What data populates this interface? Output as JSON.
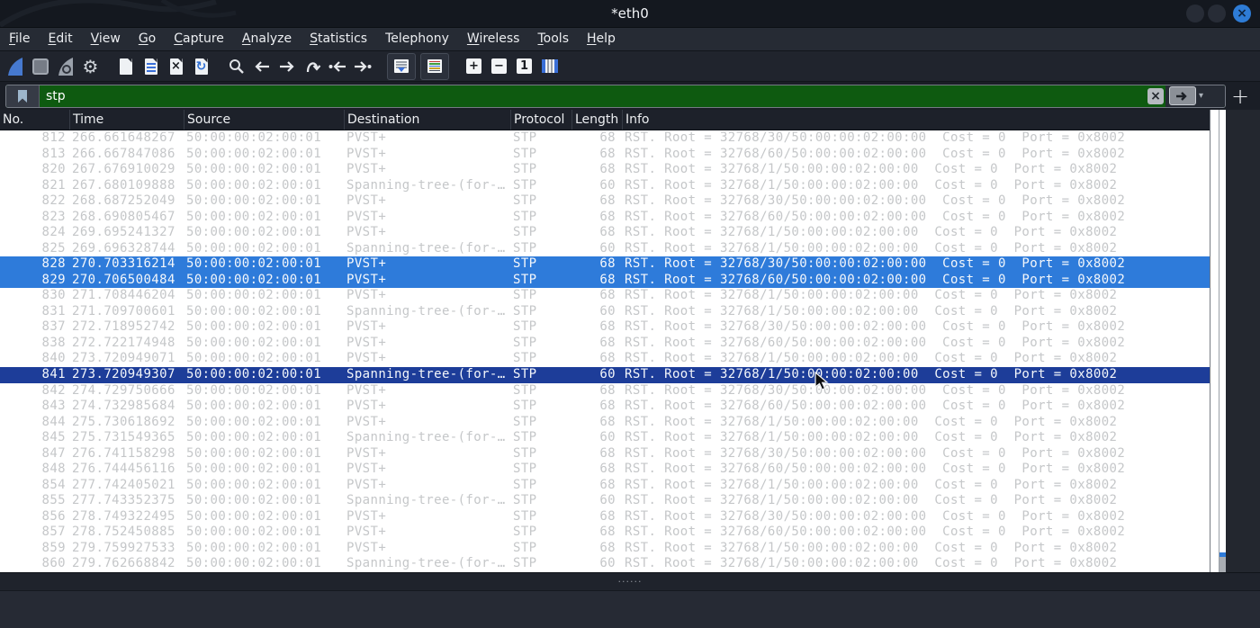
{
  "window": {
    "title": "*eth0"
  },
  "menu": {
    "items": [
      {
        "label": "File",
        "mnemonic": true
      },
      {
        "label": "Edit",
        "mnemonic": true
      },
      {
        "label": "View",
        "mnemonic": true
      },
      {
        "label": "Go",
        "mnemonic": true
      },
      {
        "label": "Capture",
        "mnemonic": true
      },
      {
        "label": "Analyze",
        "mnemonic": true
      },
      {
        "label": "Statistics",
        "mnemonic": true
      },
      {
        "label": "Telephony",
        "mnemonic": false
      },
      {
        "label": "Wireless",
        "mnemonic": true
      },
      {
        "label": "Tools",
        "mnemonic": true
      },
      {
        "label": "Help",
        "mnemonic": true
      }
    ]
  },
  "toolbar": {
    "icons": [
      "start-capture",
      "stop-capture",
      "restart-capture",
      "capture-options",
      "open-file",
      "save-file",
      "close-file",
      "reload-file",
      "find-packet",
      "go-back",
      "go-forward",
      "go-to-packet",
      "go-first-packet",
      "go-last-packet",
      "auto-scroll",
      "colorize-packets",
      "zoom-in",
      "zoom-out",
      "normal-size",
      "resize-columns"
    ]
  },
  "icons": {
    "glyphs": {
      "gear": "⚙",
      "reload": "↻",
      "close_doc_x": "×",
      "zoom_in": "+",
      "zoom_out": "−",
      "normal_size": "1",
      "caret": "▾",
      "clear_x": "×",
      "close_x": "×",
      "plus": "+",
      "dots": "······"
    }
  },
  "filter": {
    "value": "stp"
  },
  "packet_table": {
    "columns": [
      "No.",
      "Time",
      "Source",
      "Destination",
      "Protocol",
      "Length",
      "Info"
    ],
    "rows": [
      [
        "812",
        "266.661648267",
        "50:00:00:02:00:01",
        "PVST+",
        "STP",
        "68",
        "RST. Root = 32768/30/50:00:00:02:00:00  Cost = 0  Port = 0x8002",
        ""
      ],
      [
        "813",
        "266.667847086",
        "50:00:00:02:00:01",
        "PVST+",
        "STP",
        "68",
        "RST. Root = 32768/60/50:00:00:02:00:00  Cost = 0  Port = 0x8002",
        ""
      ],
      [
        "820",
        "267.676910029",
        "50:00:00:02:00:01",
        "PVST+",
        "STP",
        "68",
        "RST. Root = 32768/1/50:00:00:02:00:00  Cost = 0  Port = 0x8002",
        ""
      ],
      [
        "821",
        "267.680109888",
        "50:00:00:02:00:01",
        "Spanning-tree-(for-…",
        "STP",
        "60",
        "RST. Root = 32768/1/50:00:00:02:00:00  Cost = 0  Port = 0x8002",
        ""
      ],
      [
        "822",
        "268.687252049",
        "50:00:00:02:00:01",
        "PVST+",
        "STP",
        "68",
        "RST. Root = 32768/30/50:00:00:02:00:00  Cost = 0  Port = 0x8002",
        ""
      ],
      [
        "823",
        "268.690805467",
        "50:00:00:02:00:01",
        "PVST+",
        "STP",
        "68",
        "RST. Root = 32768/60/50:00:00:02:00:00  Cost = 0  Port = 0x8002",
        ""
      ],
      [
        "824",
        "269.695241327",
        "50:00:00:02:00:01",
        "PVST+",
        "STP",
        "68",
        "RST. Root = 32768/1/50:00:00:02:00:00  Cost = 0  Port = 0x8002",
        ""
      ],
      [
        "825",
        "269.696328744",
        "50:00:00:02:00:01",
        "Spanning-tree-(for-…",
        "STP",
        "60",
        "RST. Root = 32768/1/50:00:00:02:00:00  Cost = 0  Port = 0x8002",
        ""
      ],
      [
        "828",
        "270.703316214",
        "50:00:00:02:00:01",
        "PVST+",
        "STP",
        "68",
        "RST. Root = 32768/30/50:00:00:02:00:00  Cost = 0  Port = 0x8002",
        "highlight"
      ],
      [
        "829",
        "270.706500484",
        "50:00:00:02:00:01",
        "PVST+",
        "STP",
        "68",
        "RST. Root = 32768/60/50:00:00:02:00:00  Cost = 0  Port = 0x8002",
        "highlight"
      ],
      [
        "830",
        "271.708446204",
        "50:00:00:02:00:01",
        "PVST+",
        "STP",
        "68",
        "RST. Root = 32768/1/50:00:00:02:00:00  Cost = 0  Port = 0x8002",
        ""
      ],
      [
        "831",
        "271.709700601",
        "50:00:00:02:00:01",
        "Spanning-tree-(for-…",
        "STP",
        "60",
        "RST. Root = 32768/1/50:00:00:02:00:00  Cost = 0  Port = 0x8002",
        ""
      ],
      [
        "837",
        "272.718952742",
        "50:00:00:02:00:01",
        "PVST+",
        "STP",
        "68",
        "RST. Root = 32768/30/50:00:00:02:00:00  Cost = 0  Port = 0x8002",
        ""
      ],
      [
        "838",
        "272.722174948",
        "50:00:00:02:00:01",
        "PVST+",
        "STP",
        "68",
        "RST. Root = 32768/60/50:00:00:02:00:00  Cost = 0  Port = 0x8002",
        ""
      ],
      [
        "840",
        "273.720949071",
        "50:00:00:02:00:01",
        "PVST+",
        "STP",
        "68",
        "RST. Root = 32768/1/50:00:00:02:00:00  Cost = 0  Port = 0x8002",
        ""
      ],
      [
        "841",
        "273.720949307",
        "50:00:00:02:00:01",
        "Spanning-tree-(for-…",
        "STP",
        "60",
        "RST. Root = 32768/1/50:00:00:02:00:00  Cost = 0  Port = 0x8002",
        "selected"
      ],
      [
        "842",
        "274.729750666",
        "50:00:00:02:00:01",
        "PVST+",
        "STP",
        "68",
        "RST. Root = 32768/30/50:00:00:02:00:00  Cost = 0  Port = 0x8002",
        ""
      ],
      [
        "843",
        "274.732985684",
        "50:00:00:02:00:01",
        "PVST+",
        "STP",
        "68",
        "RST. Root = 32768/60/50:00:00:02:00:00  Cost = 0  Port = 0x8002",
        ""
      ],
      [
        "844",
        "275.730618692",
        "50:00:00:02:00:01",
        "PVST+",
        "STP",
        "68",
        "RST. Root = 32768/1/50:00:00:02:00:00  Cost = 0  Port = 0x8002",
        ""
      ],
      [
        "845",
        "275.731549365",
        "50:00:00:02:00:01",
        "Spanning-tree-(for-…",
        "STP",
        "60",
        "RST. Root = 32768/1/50:00:00:02:00:00  Cost = 0  Port = 0x8002",
        ""
      ],
      [
        "847",
        "276.741158298",
        "50:00:00:02:00:01",
        "PVST+",
        "STP",
        "68",
        "RST. Root = 32768/30/50:00:00:02:00:00  Cost = 0  Port = 0x8002",
        ""
      ],
      [
        "848",
        "276.744456116",
        "50:00:00:02:00:01",
        "PVST+",
        "STP",
        "68",
        "RST. Root = 32768/60/50:00:00:02:00:00  Cost = 0  Port = 0x8002",
        ""
      ],
      [
        "854",
        "277.742405021",
        "50:00:00:02:00:01",
        "PVST+",
        "STP",
        "68",
        "RST. Root = 32768/1/50:00:00:02:00:00  Cost = 0  Port = 0x8002",
        ""
      ],
      [
        "855",
        "277.743352375",
        "50:00:00:02:00:01",
        "Spanning-tree-(for-…",
        "STP",
        "60",
        "RST. Root = 32768/1/50:00:00:02:00:00  Cost = 0  Port = 0x8002",
        ""
      ],
      [
        "856",
        "278.749322495",
        "50:00:00:02:00:01",
        "PVST+",
        "STP",
        "68",
        "RST. Root = 32768/30/50:00:00:02:00:00  Cost = 0  Port = 0x8002",
        ""
      ],
      [
        "857",
        "278.752450885",
        "50:00:00:02:00:01",
        "PVST+",
        "STP",
        "68",
        "RST. Root = 32768/60/50:00:00:02:00:00  Cost = 0  Port = 0x8002",
        ""
      ],
      [
        "859",
        "279.759927533",
        "50:00:00:02:00:01",
        "PVST+",
        "STP",
        "68",
        "RST. Root = 32768/1/50:00:00:02:00:00  Cost = 0  Port = 0x8002",
        ""
      ],
      [
        "860",
        "279.762668842",
        "50:00:00:02:00:01",
        "Spanning-tree-(for-…",
        "STP",
        "60",
        "RST. Root = 32768/1/50:00:00:02:00:00  Cost = 0  Port = 0x8002",
        ""
      ]
    ]
  },
  "colors": {
    "titlebar_bg": "#14181f",
    "menubar_bg": "#262b34",
    "toolbar_bg": "#20242d",
    "filter_green": "#0e5a10",
    "header_bg": "#1d212a",
    "list_bg": "#ffffff",
    "row_text": "#c5c7c9",
    "highlight_row_bg": "#2e7bda",
    "selected_row_bg": "#1d3d99",
    "close_button_blue": "#2e7cd6"
  }
}
